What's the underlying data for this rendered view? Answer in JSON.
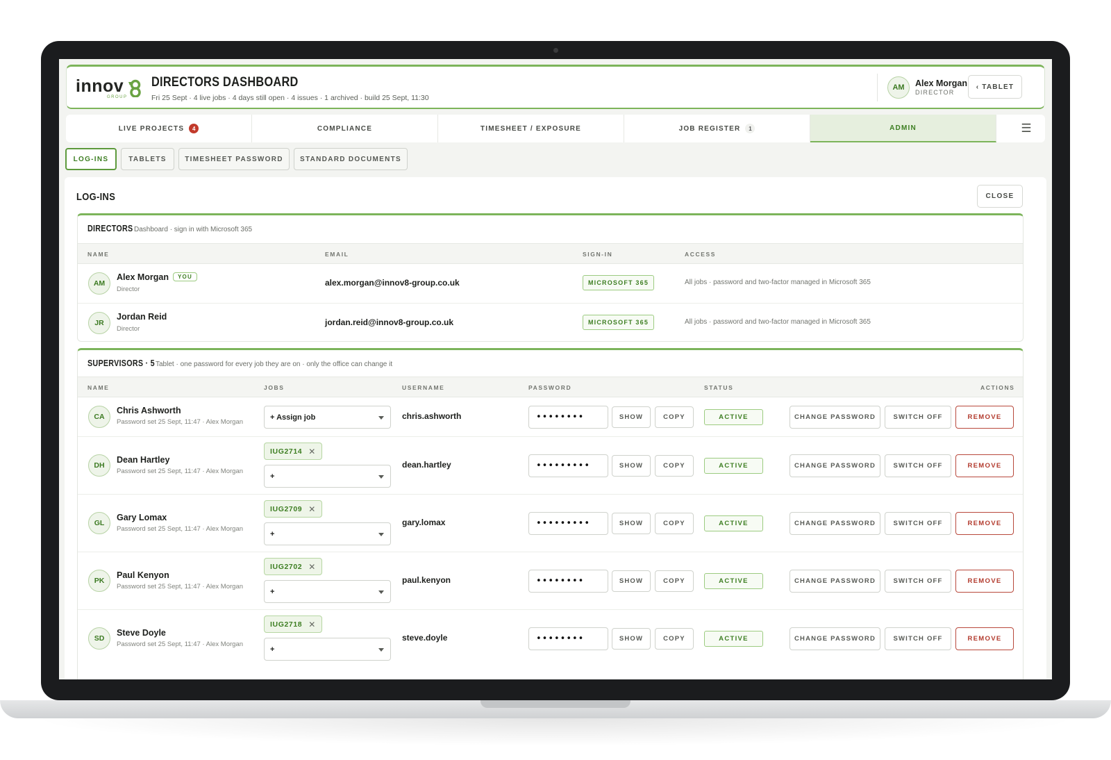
{
  "brand": {
    "word": "innov",
    "group": "GROUP",
    "accent": "#7cb45a"
  },
  "header": {
    "title": "DIRECTORS DASHBOARD",
    "subtitle": "Fri 25 Sept · 4 live jobs · 4 days still open · 4 issues · 1 archived · build 25 Sept, 11:30",
    "user": {
      "initials": "AM",
      "name": "Alex Morgan",
      "role": "DIRECTOR"
    },
    "tablet_button": "‹ TABLET"
  },
  "tabs": [
    {
      "label": "LIVE PROJECTS",
      "badge": "4",
      "badge_color": "#c23a2b"
    },
    {
      "label": "COMPLIANCE",
      "badge": ""
    },
    {
      "label": "TIMESHEET / EXPOSURE",
      "badge": ""
    },
    {
      "label": "JOB REGISTER",
      "badge": "1"
    },
    {
      "label": "ADMIN",
      "badge": "",
      "active": true
    }
  ],
  "menu_icon": "hamburger-icon",
  "subtabs": [
    "LOG-INS",
    "TABLETS",
    "TIMESHEET PASSWORD",
    "STANDARD DOCUMENTS"
  ],
  "panel": {
    "title": "LOG-INS",
    "close": "CLOSE"
  },
  "directors": {
    "title": "DIRECTORS",
    "note": "Dashboard · sign in with Microsoft 365",
    "columns": [
      "NAME",
      "EMAIL",
      "SIGN-IN",
      "ACCESS"
    ],
    "rows": [
      {
        "initials": "AM",
        "name": "Alex Morgan",
        "you": "YOU",
        "role": "Director",
        "email": "alex.morgan@innov8-group.co.uk",
        "signin": "MICROSOFT 365",
        "access": "All jobs · password and two-factor managed in Microsoft 365"
      },
      {
        "initials": "JR",
        "name": "Jordan Reid",
        "role": "Director",
        "email": "jordan.reid@innov8-group.co.uk",
        "signin": "MICROSOFT 365",
        "access": "All jobs · password and two-factor managed in Microsoft 365"
      }
    ]
  },
  "supervisors": {
    "title": "SUPERVISORS · 5",
    "note": "Tablet · one password for every job they are on · only the office can change it",
    "columns": [
      "NAME",
      "JOBS",
      "USERNAME",
      "PASSWORD",
      "STATUS",
      "ACTIONS"
    ],
    "buttons": {
      "show": "SHOW",
      "copy": "COPY",
      "change": "CHANGE PASSWORD",
      "switch_off": "SWITCH OFF",
      "remove": "REMOVE"
    },
    "rows": [
      {
        "initials": "CA",
        "name": "Chris Ashworth",
        "note": "Password set 25 Sept, 11:47 · Alex Morgan",
        "job": "",
        "select": "+ Assign job",
        "username": "chris.ashworth",
        "password": "••••••••",
        "status": "ACTIVE"
      },
      {
        "initials": "DH",
        "name": "Dean Hartley",
        "note": "Password set 25 Sept, 11:47 · Alex Morgan",
        "job": "IUG2714",
        "select": "+",
        "username": "dean.hartley",
        "password": "•••••••••",
        "status": "ACTIVE"
      },
      {
        "initials": "GL",
        "name": "Gary Lomax",
        "note": "Password set 25 Sept, 11:47 · Alex Morgan",
        "job": "IUG2709",
        "select": "+",
        "username": "gary.lomax",
        "password": "•••••••••",
        "status": "ACTIVE"
      },
      {
        "initials": "PK",
        "name": "Paul Kenyon",
        "note": "Password set 25 Sept, 11:47 · Alex Morgan",
        "job": "IUG2702",
        "select": "+",
        "username": "paul.kenyon",
        "password": "••••••••",
        "status": "ACTIVE"
      },
      {
        "initials": "SD",
        "name": "Steve Doyle",
        "note": "Password set 25 Sept, 11:47 · Alex Morgan",
        "job": "IUG2718",
        "select": "+",
        "username": "steve.doyle",
        "password": "••••••••",
        "status": "ACTIVE"
      }
    ]
  }
}
